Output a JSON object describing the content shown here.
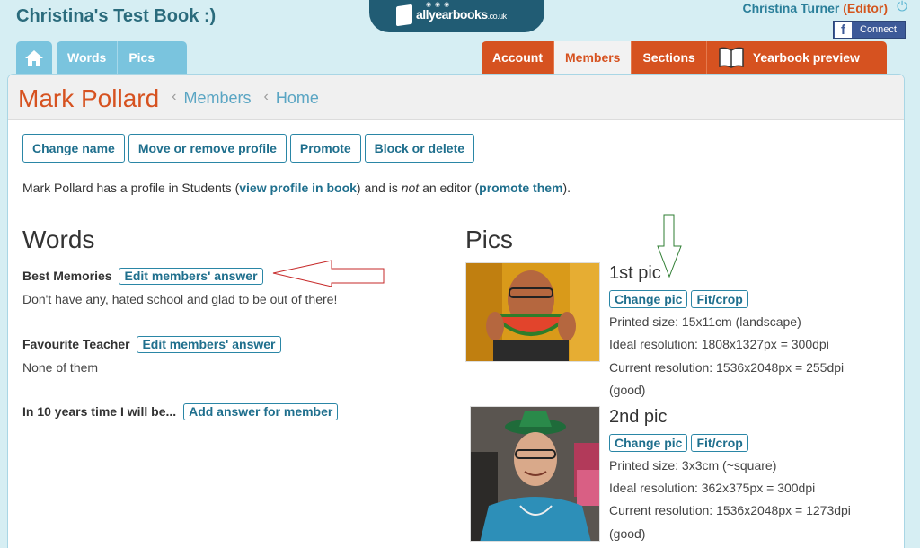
{
  "header": {
    "book_title": "Christina's Test Book :)",
    "logo_text": "allyearbooks",
    "logo_suffix": ".co.uk",
    "user_name": "Christina Turner",
    "user_role": "(Editor)",
    "facebook_label": "Connect"
  },
  "nav": {
    "left_tabs": [
      "Words",
      "Pics"
    ],
    "right_tabs": [
      "Account",
      "Members",
      "Sections"
    ],
    "preview_label": "Yearbook preview",
    "active_tab": "Members"
  },
  "page": {
    "title": "Mark Pollard",
    "breadcrumbs": [
      "Members",
      "Home"
    ]
  },
  "actions": [
    "Change name",
    "Move or remove profile",
    "Promote",
    "Block or delete"
  ],
  "info": {
    "prefix": "Mark Pollard has a profile in Students (",
    "view_link": "view profile in book",
    "middle1": ") and is ",
    "not_word": "not",
    "middle2": " an editor (",
    "promote_link": "promote them",
    "suffix": ")."
  },
  "words": {
    "title": "Words",
    "questions": [
      {
        "label": "Best Memories",
        "button": "Edit members' answer",
        "answer": "Don't have any, hated school and glad to be out of there!"
      },
      {
        "label": "Favourite Teacher",
        "button": "Edit members' answer",
        "answer": "None of them"
      },
      {
        "label": "In 10 years time I will be...",
        "button": "Add answer for member",
        "answer": ""
      }
    ]
  },
  "pics": {
    "title": "Pics",
    "items": [
      {
        "title": "1st pic",
        "change_label": "Change pic",
        "fit_label": "Fit/crop",
        "printed_size": "Printed size: 15x11cm (landscape)",
        "ideal_resolution": "Ideal resolution: 1808x1327px = 300dpi",
        "current_resolution": "Current resolution: 1536x2048px = 255dpi",
        "quality": "(good)"
      },
      {
        "title": "2nd pic",
        "change_label": "Change pic",
        "fit_label": "Fit/crop",
        "printed_size": "Printed size: 3x3cm (~square)",
        "ideal_resolution": "Ideal resolution: 362x375px = 300dpi",
        "current_resolution": "Current resolution: 1536x2048px = 1273dpi",
        "quality": "(good)"
      }
    ]
  },
  "colors": {
    "accent_orange": "#d65220",
    "accent_blue": "#1f6f8d",
    "tab_blue": "#7ac4de",
    "annotation_red": "#c62828",
    "annotation_green": "#2e7d32"
  }
}
